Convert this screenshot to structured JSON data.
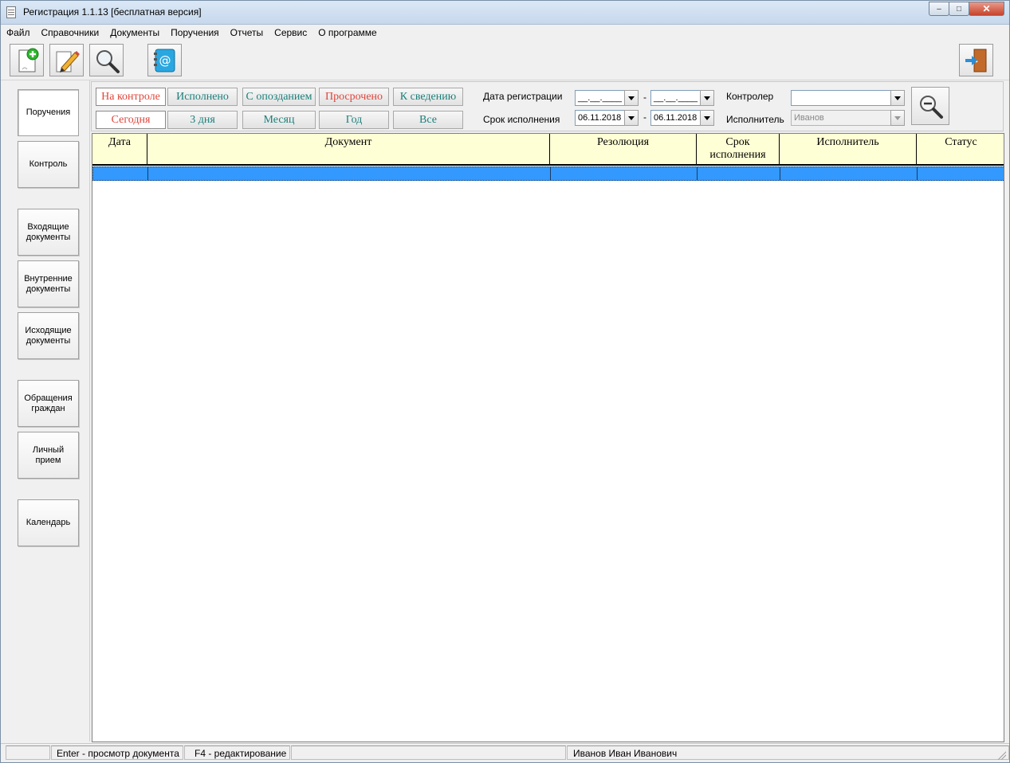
{
  "window": {
    "title": "Регистрация 1.1.13 [бесплатная версия]",
    "controls": {
      "minimize": "–",
      "maximize": "□",
      "close": "✕"
    }
  },
  "menu": [
    "Файл",
    "Справочники",
    "Документы",
    "Поручения",
    "Отчеты",
    "Сервис",
    "О программе"
  ],
  "toolbar": {
    "icons": [
      "new-document-icon",
      "edit-pencil-icon",
      "search-magnifier-icon",
      "address-book-icon",
      "exit-door-icon"
    ]
  },
  "nav": [
    {
      "label": "Поручения",
      "active": true
    },
    {
      "label": "Контроль"
    },
    {
      "label": "Входящие\nдокументы"
    },
    {
      "label": "Внутренние\nдокументы"
    },
    {
      "label": "Исходящие\nдокументы"
    },
    {
      "label": "Обращения\nграждан"
    },
    {
      "label": "Личный\nприем"
    },
    {
      "label": "Календарь"
    }
  ],
  "filters": {
    "status_buttons": [
      "На контроле",
      "Исполнено",
      "С опозданием",
      "Просрочено",
      "К сведению"
    ],
    "period_buttons": [
      "Сегодня",
      "3 дня",
      "Месяц",
      "Год",
      "Все"
    ],
    "registration_date_label": "Дата регистрации",
    "registration_from": "__.__.____",
    "registration_to": "__.__.____",
    "deadline_label": "Срок исполнения",
    "deadline_from": "06.11.2018",
    "deadline_to": "06.11.2018",
    "range_separator": "-",
    "controller_label": "Контролер",
    "controller_value": "",
    "executor_label": "Исполнитель",
    "executor_value": "Иванов"
  },
  "grid": {
    "columns": [
      "Дата",
      "Документ",
      "Резолюция",
      "Срок\nисполнения",
      "Исполнитель",
      "Статус"
    ],
    "rows": []
  },
  "statusbar": {
    "hint_view": "Enter - просмотр документа",
    "hint_edit": "F4 - редактирование",
    "user": "Иванов Иван Иванович"
  },
  "colors": {
    "grid_header_bg": "#ffffd5",
    "selected_row": "#3399ff",
    "filter_red": "#e0453a",
    "filter_teal": "#1a7f7a"
  }
}
